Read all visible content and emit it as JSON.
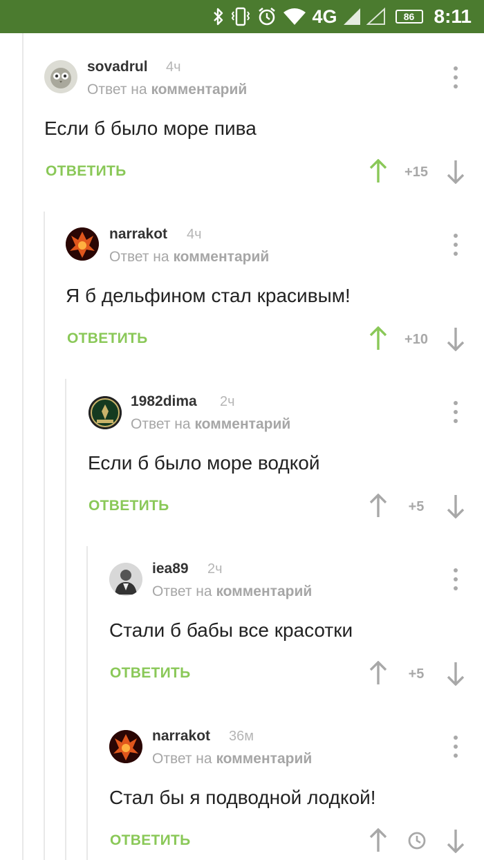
{
  "status_bar": {
    "network": "4G",
    "battery": "86",
    "time": "8:11"
  },
  "reply_prefix": "Ответ на",
  "reply_target": "комментарий",
  "reply_label": "ОТВЕТИТЬ",
  "colors": {
    "status_bar_bg": "#4b7b2f",
    "accent_green": "#8ac858",
    "upvote_active": "#8ac858",
    "muted_gray": "#a8a8a8"
  },
  "comments": [
    {
      "username": "sovadrul",
      "time_ago": "4ч",
      "text": "Если б было море пива",
      "score": "+15",
      "upvoted": true
    },
    {
      "username": "narrakot",
      "time_ago": "4ч",
      "text": "Я б дельфином стал красивым!",
      "score": "+10",
      "upvoted": true
    },
    {
      "username": "1982dima",
      "time_ago": "2ч",
      "text": "Если б было море водкой",
      "score": "+5",
      "upvoted": false
    },
    {
      "username": "iea89",
      "time_ago": "2ч",
      "text": "Стали б бабы все красотки",
      "score": "+5",
      "upvoted": false
    },
    {
      "username": "narrakot",
      "time_ago": "36м",
      "text": "Стал бы я подводной лодкой!",
      "score": "",
      "score_icon": "clock-icon",
      "upvoted": false
    }
  ]
}
